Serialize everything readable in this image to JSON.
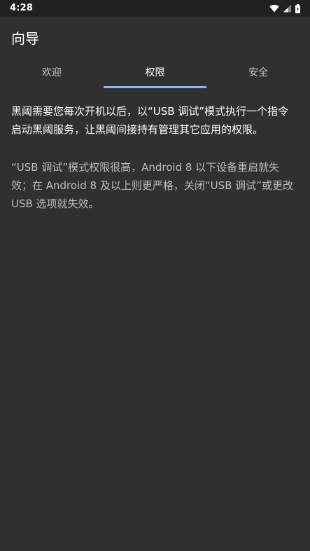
{
  "status_bar": {
    "time": "4:28",
    "icons": [
      "wifi-icon",
      "cell-signal-icon",
      "battery-icon"
    ]
  },
  "app_bar": {
    "title": "向导"
  },
  "tabs": [
    {
      "label": "欢迎",
      "active": false
    },
    {
      "label": "权限",
      "active": true
    },
    {
      "label": "安全",
      "active": false
    }
  ],
  "content": {
    "main_text": "黑阈需要您每次开机以后，以“USB 调试”模式执行一个指令启动黑阈服务，让黑阈间接持有管理其它应用的权限。",
    "note_text": "“USB 调试”模式权限很高，Android 8 以下设备重启就失效；在 Android 8 及以上则更严格，关闭“USB 调试”或更改 USB 选项就失效。"
  },
  "colors": {
    "background": "#303030",
    "status_bar": "#212121",
    "accent": "#8ab4f8",
    "secondary_text": "#bdbdbd"
  }
}
